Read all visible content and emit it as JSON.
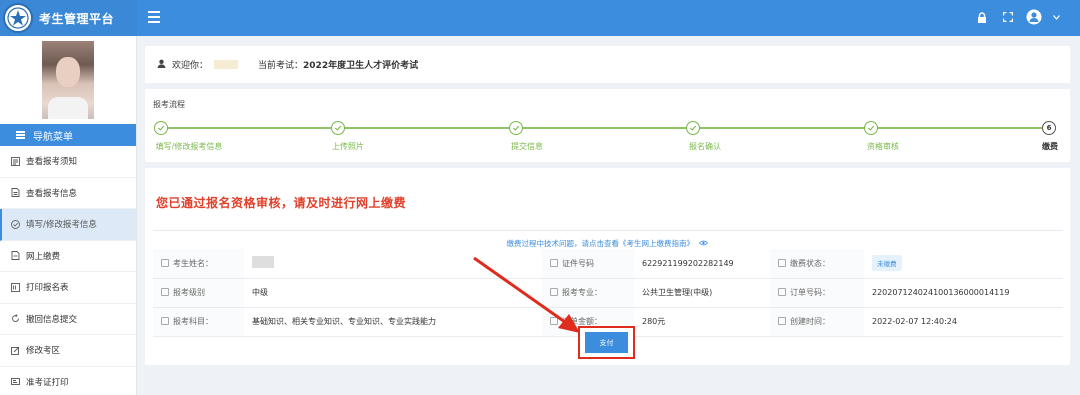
{
  "header": {
    "app_title": "考生管理平台"
  },
  "sidebar": {
    "nav_title": "导航菜单",
    "items": [
      {
        "label": "查看报考须知",
        "icon": "document-icon"
      },
      {
        "label": "查看报考信息",
        "icon": "file-icon"
      },
      {
        "label": "填写/修改报考信息",
        "icon": "check-circle-icon",
        "active": true
      },
      {
        "label": "网上缴费",
        "icon": "payment-icon"
      },
      {
        "label": "打印报名表",
        "icon": "print-icon"
      },
      {
        "label": "撤回信息提交",
        "icon": "undo-icon"
      },
      {
        "label": "修改考区",
        "icon": "edit-icon"
      },
      {
        "label": "准考证打印",
        "icon": "id-card-icon"
      }
    ]
  },
  "welcome": {
    "greeting": "欢迎你：",
    "exam_label": "当前考试：",
    "exam_name": "2022年度卫生人才评价考试"
  },
  "progress": {
    "title": "报考流程",
    "steps": [
      {
        "label": "填写/修改报考信息",
        "done": true
      },
      {
        "label": "上传照片",
        "done": true
      },
      {
        "label": "提交信息",
        "done": true
      },
      {
        "label": "报名确认",
        "done": true
      },
      {
        "label": "资格审核",
        "done": true
      },
      {
        "label": "缴费",
        "done": false,
        "number": "6"
      }
    ]
  },
  "main": {
    "notice": "您已通过报名资格审核，请及时进行网上缴费",
    "hint": "缴费过程中技术问题，请点击查看《考生网上缴费指南》",
    "fields": {
      "name_label": "考生姓名：",
      "id_label": "证件号码",
      "id_value": "622921199202282149",
      "status_label": "缴费状态：",
      "status_value": "未缴费",
      "level_label": "报考级别",
      "level_value": "中级",
      "major_label": "报考专业：",
      "major_value": "公共卫生管理(中级)",
      "order_label": "订单号码：",
      "order_value": "220207124024100136000014119",
      "subjects_label": "报考科目：",
      "subjects_value": "基础知识、相关专业知识、专业知识、专业实践能力",
      "amount_label": "订单金额：",
      "amount_value": "280元",
      "created_label": "创建时间：",
      "created_value": "2022-02-07 12:40:24"
    },
    "pay_button": "支付"
  },
  "colors": {
    "primary": "#3c8dde",
    "success": "#7ab84a",
    "alert": "#e0402b",
    "highlight": "#e02b1f"
  }
}
